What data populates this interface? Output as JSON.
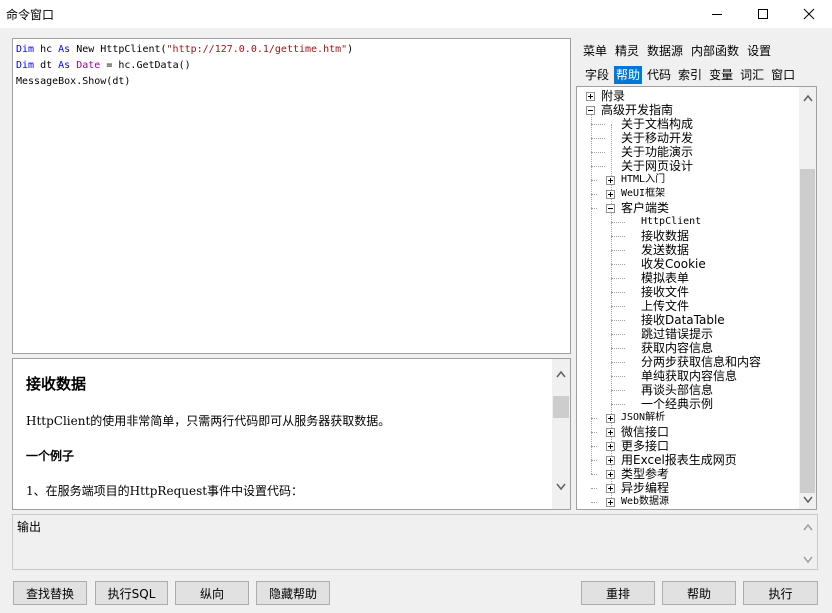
{
  "window": {
    "title": "命令窗口"
  },
  "editor": {
    "lines": [
      [
        {
          "t": "Dim",
          "c": "kw"
        },
        {
          "t": " hc ",
          "c": ""
        },
        {
          "t": "As",
          "c": "kw"
        },
        {
          "t": " New HttpClient(",
          "c": ""
        },
        {
          "t": "\"http://127.0.0.1/gettime.htm\"",
          "c": "str"
        },
        {
          "t": ")",
          "c": ""
        }
      ],
      [
        {
          "t": "Dim",
          "c": "kw"
        },
        {
          "t": " dt ",
          "c": ""
        },
        {
          "t": "As",
          "c": "kw"
        },
        {
          "t": " ",
          "c": ""
        },
        {
          "t": "Date",
          "c": "dt"
        },
        {
          "t": " = hc.GetData()",
          "c": ""
        }
      ],
      [
        {
          "t": "MessageBox.Show(dt)",
          "c": ""
        }
      ]
    ]
  },
  "help": {
    "title": "接收数据",
    "paragraphs": [
      "HttpClient的使用非常简单，只需两行代码即可从服务器获取数据。",
      "一个例子",
      "1、在服务端项目的HttpRequest事件中设置代码："
    ]
  },
  "output": {
    "label": "输出"
  },
  "buttons": {
    "find_replace": "查找替换",
    "exec_sql": "执行SQL",
    "vertical": "纵向",
    "hide_help": "隐藏帮助",
    "rearrange": "重排",
    "help": "帮助",
    "execute": "执行"
  },
  "menu_row1": [
    "菜单",
    "精灵",
    "数据源",
    "内部函数",
    "设置"
  ],
  "menu_row2": [
    "字段",
    "帮助",
    "代码",
    "索引",
    "变量",
    "词汇",
    "窗口"
  ],
  "menu_row2_active": 1,
  "tree": {
    "nodes": [
      {
        "label": "附录",
        "level": 0,
        "toggle": "plus"
      },
      {
        "label": "高级开发指南",
        "level": 0,
        "toggle": "minus"
      },
      {
        "label": "关于文档构成",
        "level": 1,
        "toggle": ""
      },
      {
        "label": "关于移动开发",
        "level": 1,
        "toggle": ""
      },
      {
        "label": "关于功能演示",
        "level": 1,
        "toggle": ""
      },
      {
        "label": "关于网页设计",
        "level": 1,
        "toggle": ""
      },
      {
        "label": "HTML入门",
        "level": 1,
        "toggle": "plus"
      },
      {
        "label": "WeUI框架",
        "level": 1,
        "toggle": "plus"
      },
      {
        "label": "客户端类",
        "level": 1,
        "toggle": "minus"
      },
      {
        "label": "HttpClient",
        "level": 2,
        "toggle": ""
      },
      {
        "label": "接收数据",
        "level": 2,
        "toggle": ""
      },
      {
        "label": "发送数据",
        "level": 2,
        "toggle": ""
      },
      {
        "label": "收发Cookie",
        "level": 2,
        "toggle": ""
      },
      {
        "label": "模拟表单",
        "level": 2,
        "toggle": ""
      },
      {
        "label": "接收文件",
        "level": 2,
        "toggle": ""
      },
      {
        "label": "上传文件",
        "level": 2,
        "toggle": ""
      },
      {
        "label": "接收DataTable",
        "level": 2,
        "toggle": ""
      },
      {
        "label": "跳过错误提示",
        "level": 2,
        "toggle": ""
      },
      {
        "label": "获取内容信息",
        "level": 2,
        "toggle": ""
      },
      {
        "label": "分两步获取信息和内容",
        "level": 2,
        "toggle": ""
      },
      {
        "label": "单纯获取内容信息",
        "level": 2,
        "toggle": ""
      },
      {
        "label": "再谈头部信息",
        "level": 2,
        "toggle": ""
      },
      {
        "label": "一个经典示例",
        "level": 2,
        "toggle": ""
      },
      {
        "label": "JSON解析",
        "level": 1,
        "toggle": "plus"
      },
      {
        "label": "微信接口",
        "level": 1,
        "toggle": "plus"
      },
      {
        "label": "更多接口",
        "level": 1,
        "toggle": "plus"
      },
      {
        "label": "用Excel报表生成网页",
        "level": 1,
        "toggle": "plus"
      },
      {
        "label": "类型参考",
        "level": 1,
        "toggle": "plus"
      },
      {
        "label": "异步编程",
        "level": 1,
        "toggle": "plus"
      },
      {
        "label": "Web数据源",
        "level": 1,
        "toggle": "plus"
      }
    ]
  }
}
